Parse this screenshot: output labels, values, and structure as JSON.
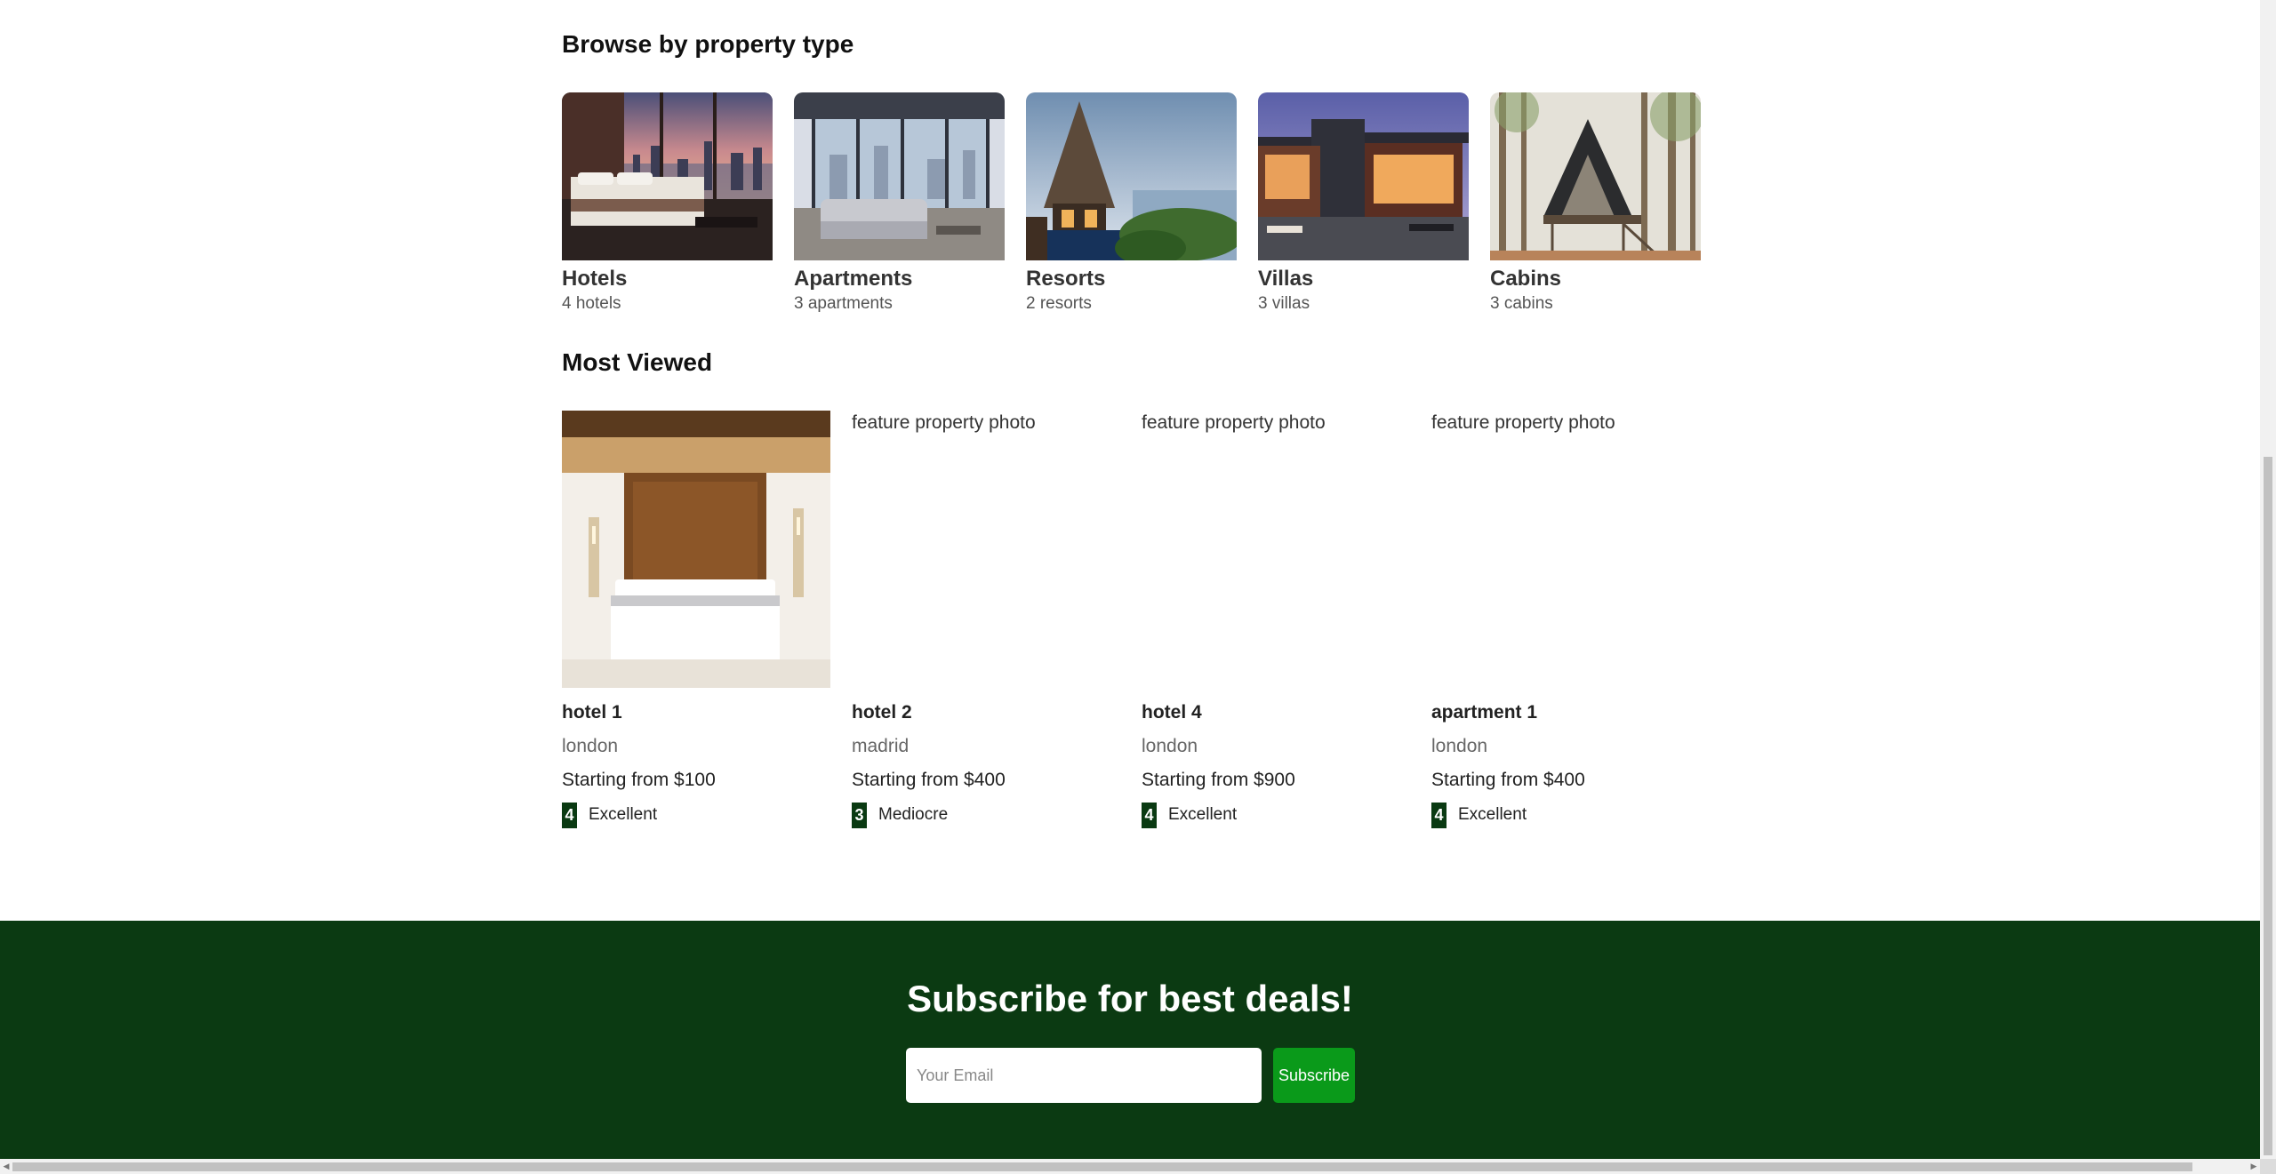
{
  "browse": {
    "title": "Browse by property type",
    "types": [
      {
        "name": "Hotels",
        "count": "4 hotels"
      },
      {
        "name": "Apartments",
        "count": "3 apartments"
      },
      {
        "name": "Resorts",
        "count": "2 resorts"
      },
      {
        "name": "Villas",
        "count": "3 villas"
      },
      {
        "name": "Cabins",
        "count": "3 cabins"
      }
    ]
  },
  "most_viewed": {
    "title": "Most Viewed",
    "image_alt": "feature property photo",
    "items": [
      {
        "name": "hotel 1",
        "city": "london",
        "price": "Starting from $100",
        "rating": "4",
        "rating_label": "Excellent"
      },
      {
        "name": "hotel 2",
        "city": "madrid",
        "price": "Starting from $400",
        "rating": "3",
        "rating_label": "Mediocre"
      },
      {
        "name": "hotel 4",
        "city": "london",
        "price": "Starting from $900",
        "rating": "4",
        "rating_label": "Excellent"
      },
      {
        "name": "apartment 1",
        "city": "london",
        "price": "Starting from $400",
        "rating": "4",
        "rating_label": "Excellent"
      }
    ]
  },
  "subscribe": {
    "title": "Subscribe for best deals!",
    "email_placeholder": "Your Email",
    "button_label": "Subscribe"
  },
  "colors": {
    "brand_dark_green": "#0b3a12",
    "button_green": "#0a9a1a",
    "rating_badge": "#0a3a12"
  }
}
